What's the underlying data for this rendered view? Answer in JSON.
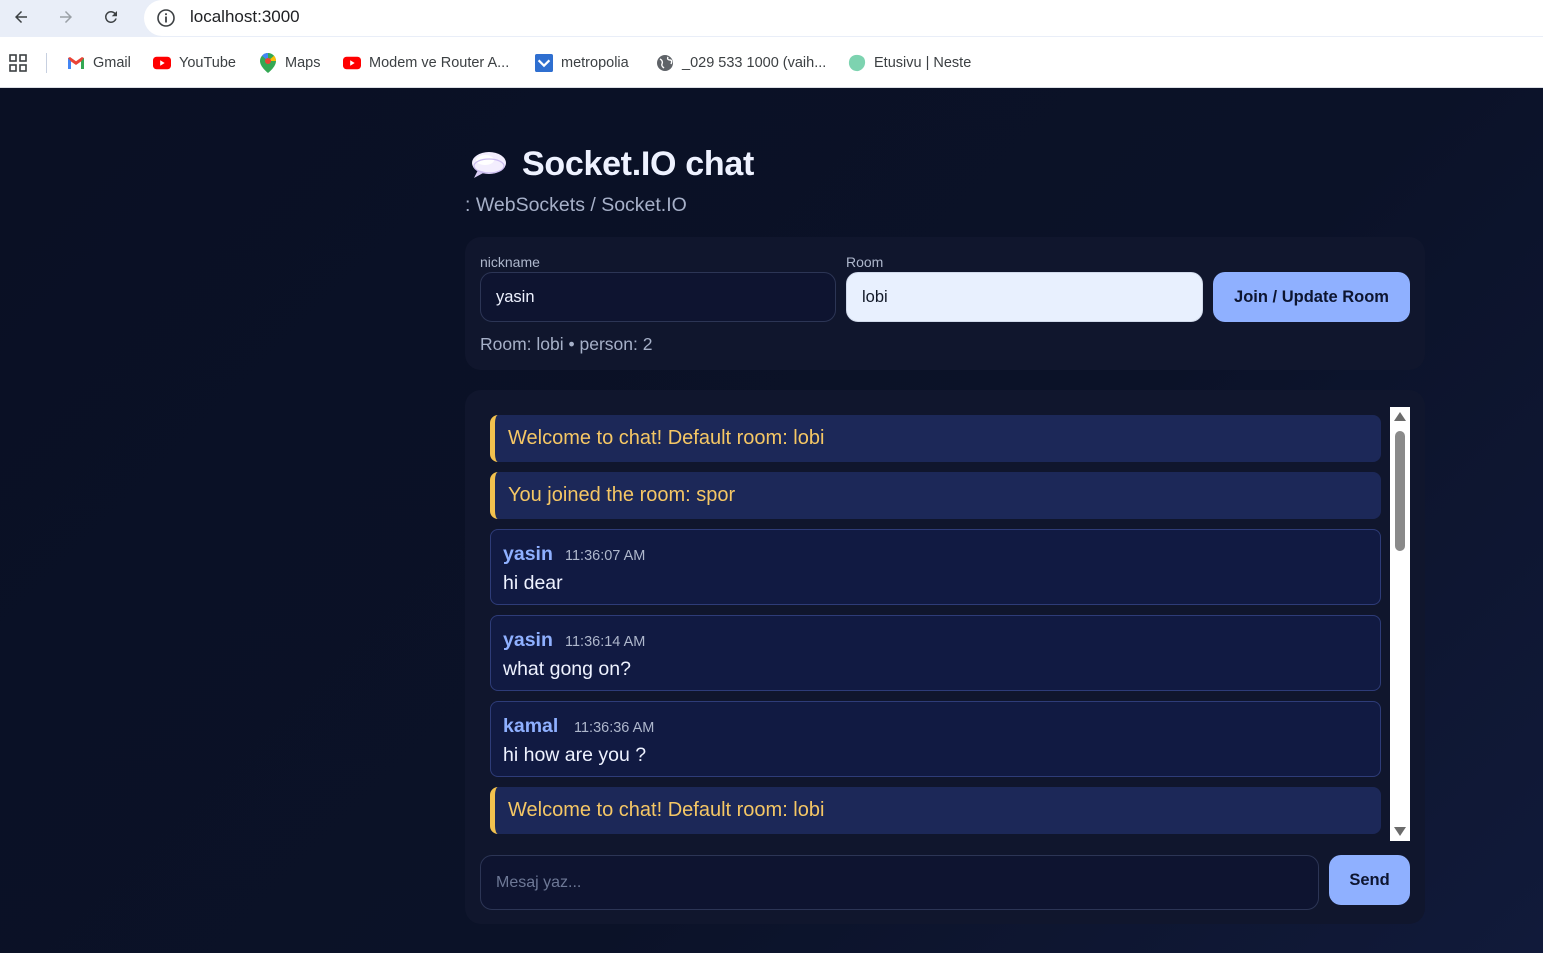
{
  "browser": {
    "url": "localhost:3000",
    "bookmarks": [
      {
        "label": "Gmail",
        "icon": "gmail-icon"
      },
      {
        "label": "YouTube",
        "icon": "youtube-icon"
      },
      {
        "label": "Maps",
        "icon": "maps-icon"
      },
      {
        "label": "Modem ve Router A...",
        "icon": "youtube-icon"
      },
      {
        "label": "metropolia",
        "icon": "metropolia-icon"
      },
      {
        "label": "_029 533 1000 (vaih...",
        "icon": "globe-icon"
      },
      {
        "label": "Etusivu | Neste",
        "icon": "neste-icon"
      }
    ]
  },
  "app": {
    "title": "Socket.IO chat",
    "subtitle": ": WebSockets / Socket.IO"
  },
  "form": {
    "nickname_label": "nickname",
    "nickname_value": "yasin",
    "room_label": "Room",
    "room_value": "lobi",
    "join_button": "Join / Update Room",
    "room_info": "Room: lobi • person: 2"
  },
  "messages": [
    {
      "type": "system",
      "text": "Welcome to chat! Default room: lobi"
    },
    {
      "type": "system",
      "text": "You joined the room: spor"
    },
    {
      "type": "user",
      "user": "yasin",
      "time": "11:36:07 AM",
      "text": "hi dear"
    },
    {
      "type": "user",
      "user": "yasin",
      "time": "11:36:14 AM",
      "text": "what gong on?"
    },
    {
      "type": "user",
      "user": "kamal",
      "time": "11:36:36 AM",
      "text": "hi how are you ?"
    },
    {
      "type": "system",
      "text": "Welcome to chat! Default room: lobi"
    }
  ],
  "composer": {
    "placeholder": "Mesaj yaz...",
    "send_button": "Send"
  },
  "colors": {
    "accent": "#8fb0ff",
    "system_text": "#f5c765",
    "system_border": "#f2c14e",
    "background": "#0b1120"
  }
}
